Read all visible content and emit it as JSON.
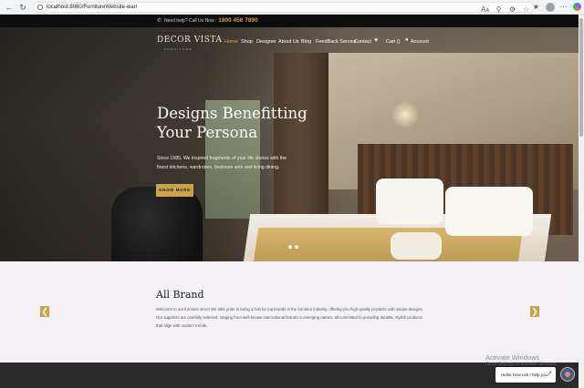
{
  "browser": {
    "url": "localhost:8080/FurnitureWebsite-war/",
    "toolbar_icons": [
      "reader-icon",
      "zoom-icon",
      "bookmark-icon",
      "extensions-icon",
      "favorites-icon",
      "profile-icon",
      "more-icon",
      "copilot-icon"
    ],
    "zoom_label": "Aᴀ"
  },
  "topbar": {
    "help_label": "Need help? Call Us Now :",
    "phone": "1800 456 7890"
  },
  "header": {
    "logo": "DECOR VISTA",
    "logo_sub": "FURNITURE",
    "menu": [
      "Home",
      "Shop",
      "Designer",
      "About Us",
      "Blog",
      "FeedBack Service",
      "Contact"
    ],
    "active_menu": "Home",
    "cart": "Cart ()",
    "account": "Account"
  },
  "hero": {
    "title_line1": "Designs Benefitting",
    "title_line2": "Your Persona",
    "text": "Since 1985, We inspired fragments of your life stories with the finest kitchens, wardrobes, bedroom sets and living dining.",
    "button": "KNOW MORE",
    "slides": 3,
    "active_slide": 1
  },
  "brand": {
    "title": "All Brand",
    "text": "Welcome to our furniture store! We take pride in being a hub for top brands in the furniture industry, offering you high-quality products with unique designs. Our suppliers are carefully selected, ranging from well-known international brands to emerging names, all committed to providing durable, stylish products that align with modern trends.",
    "prev": "❮",
    "next": "❯"
  },
  "overlay": {
    "activate_title": "Activate Windows",
    "activate_sub": "Go to Settings to activate Windows.",
    "chat_text": "Hello! How can I help you?",
    "chat_close": "×"
  },
  "colors": {
    "accent": "#c9a24a",
    "topbar": "#0d0d0d",
    "brand_bg": "#f3f1f5",
    "footer": "#2a2a2a"
  }
}
